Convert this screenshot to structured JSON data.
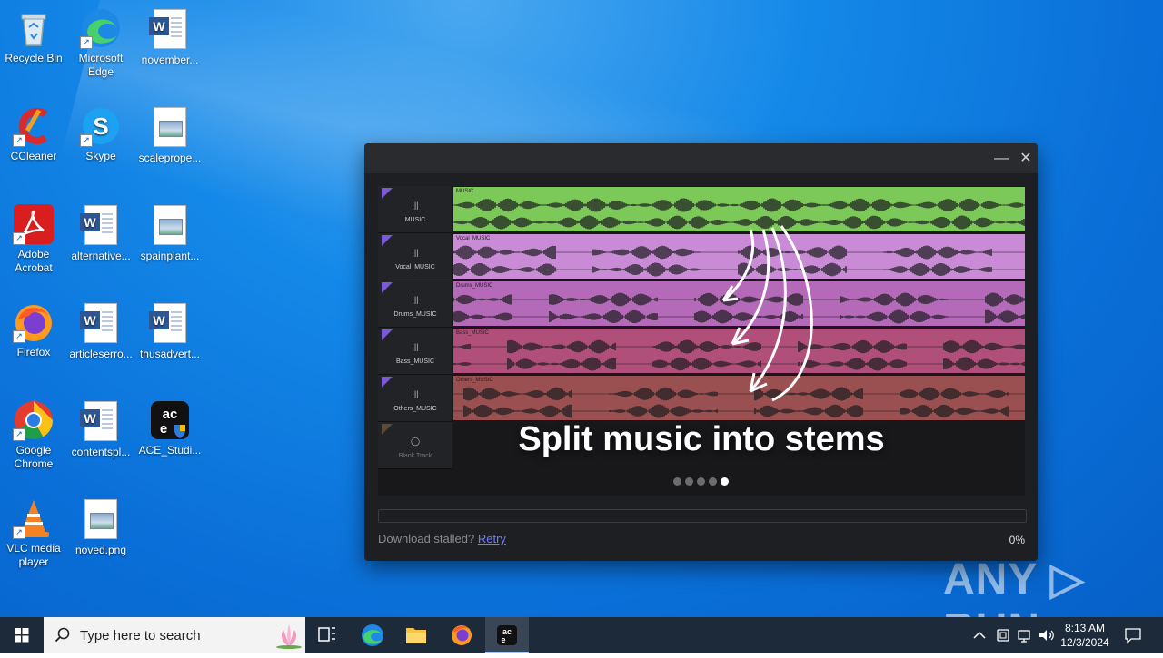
{
  "desktop": {
    "icons": [
      {
        "label": "Recycle Bin",
        "icon": "recycle-bin-icon"
      },
      {
        "label": "Microsoft Edge",
        "icon": "edge-icon"
      },
      {
        "label": "november...",
        "icon": "word-doc-icon"
      },
      {
        "label": "CCleaner",
        "icon": "ccleaner-icon"
      },
      {
        "label": "Skype",
        "icon": "skype-icon"
      },
      {
        "label": "scaleprope...",
        "icon": "image-file-icon"
      },
      {
        "label": "Adobe Acrobat",
        "icon": "acrobat-icon"
      },
      {
        "label": "alternative...",
        "icon": "word-doc-icon"
      },
      {
        "label": "spainplant...",
        "icon": "image-file-icon"
      },
      {
        "label": "Firefox",
        "icon": "firefox-icon"
      },
      {
        "label": "articleserro...",
        "icon": "word-doc-icon"
      },
      {
        "label": "thusadvert...",
        "icon": "word-doc-icon"
      },
      {
        "label": "Google Chrome",
        "icon": "chrome-icon"
      },
      {
        "label": "contentspl...",
        "icon": "word-doc-icon"
      },
      {
        "label": "ACE_Studi...",
        "icon": "ace-studio-icon"
      },
      {
        "label": "VLC media player",
        "icon": "vlc-icon"
      },
      {
        "label": "noved.png",
        "icon": "image-file-icon"
      }
    ]
  },
  "installer": {
    "minimize": "—",
    "close": "✕",
    "tracks": [
      {
        "label": "MUSIC",
        "lane_name": "MUSIC",
        "color": "#7cc95a"
      },
      {
        "label": "Vocal_MUSIC",
        "lane_name": "Vocal_MUSIC",
        "color": "#c98ad6"
      },
      {
        "label": "Drums_MUSIC",
        "lane_name": "Drums_MUSIC",
        "color": "#b46ab8"
      },
      {
        "label": "Bass_MUSIC",
        "lane_name": "Bass_MUSIC",
        "color": "#b0507a"
      },
      {
        "label": "Others_MUSIC",
        "lane_name": "Others_MUSIC",
        "color": "#9a5050"
      },
      {
        "label": "Blank Track",
        "lane_name": "",
        "color": "#2a2a2e"
      }
    ],
    "headline": "Split music into stems",
    "carousel_total": 5,
    "carousel_active_index": 4,
    "status_text": "Download stalled?",
    "retry_label": "Retry",
    "progress": "0%",
    "progress_fraction": 0
  },
  "watermark": "ANY ▷ RUN",
  "taskbar": {
    "search_placeholder": "Type here to search",
    "time": "8:13 AM",
    "date": "12/3/2024"
  }
}
